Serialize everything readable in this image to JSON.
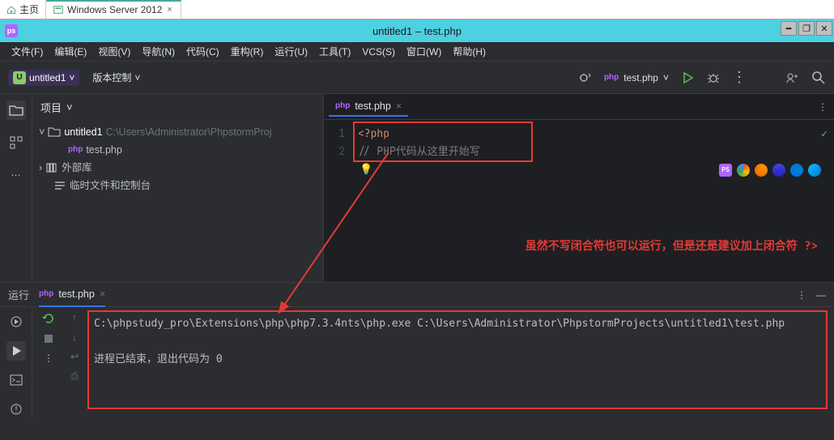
{
  "os": {
    "home": "主页",
    "tab2": "Windows Server 2012"
  },
  "title": "untitled1 – test.php",
  "menu": [
    "文件(F)",
    "编辑(E)",
    "视图(V)",
    "导航(N)",
    "代码(C)",
    "重构(R)",
    "运行(U)",
    "工具(T)",
    "VCS(S)",
    "窗口(W)",
    "帮助(H)"
  ],
  "project_name": "untitled1",
  "vcs_label": "版本控制",
  "run_config": "test.php",
  "panel": {
    "title": "项目"
  },
  "tree": {
    "root_name": "untitled1",
    "root_path": "C:\\Users\\Administrator\\PhpstormProj",
    "file1": "test.php",
    "ext_lib": "外部库",
    "scratch": "临时文件和控制台"
  },
  "editor": {
    "tab": "test.php",
    "line1": "<?php",
    "line2_prefix": "// ",
    "line2_text": "PHP代码从这里开始写"
  },
  "annotation_text": "虽然不写闭合符也可以运行，但是还是建议加上闭合符  ?>",
  "run": {
    "label": "运行",
    "tab": "test.php",
    "cmd": "C:\\phpstudy_pro\\Extensions\\php\\php7.3.4nts\\php.exe C:\\Users\\Administrator\\PhpstormProjects\\untitled1\\test.php",
    "exit": "进程已结束，退出代码为 0"
  }
}
